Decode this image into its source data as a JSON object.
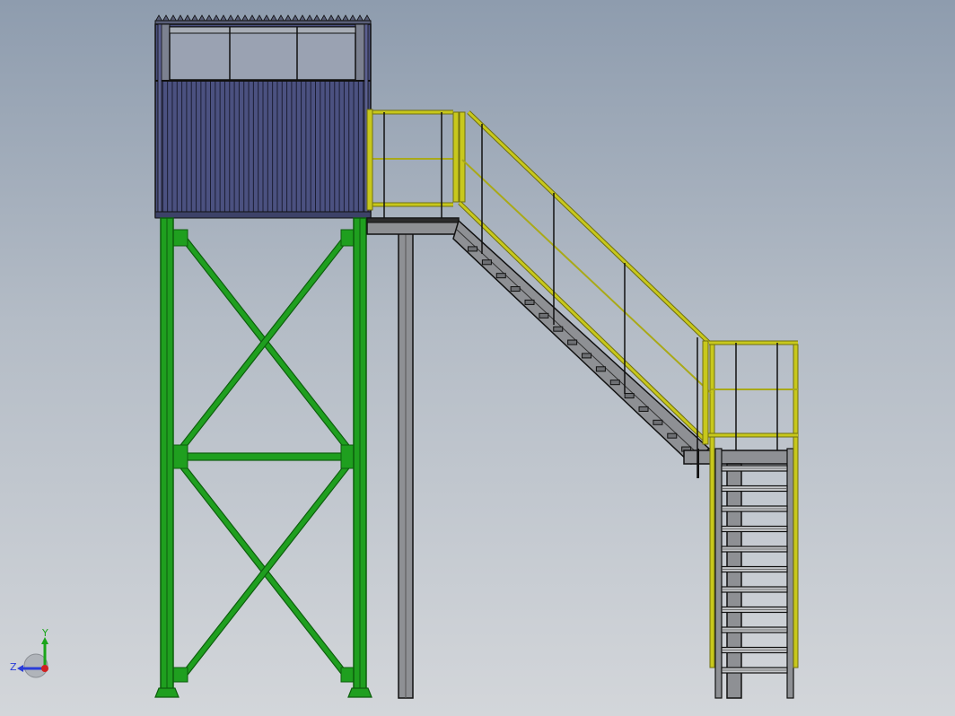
{
  "triad": {
    "y_label": "Y",
    "z_label": "Z",
    "y_color": "#1aa51a",
    "z_color": "#2a3cd8",
    "x_color": "#d02020"
  },
  "colors": {
    "tower_steel": "#1f9f1f",
    "tower_steel_dark": "#0d5e0d",
    "cabin_cladding": "#4b5180",
    "cabin_window": "#9aa2b2",
    "cabin_frame": "#7c8190",
    "handrail": "#c8c81c",
    "handrail_dark": "#6f6f10",
    "structural_grey": "#8e9094",
    "outline": "#111111"
  },
  "stair_treads": 16,
  "ladder_rungs": 11,
  "cladding_ribs": 44
}
